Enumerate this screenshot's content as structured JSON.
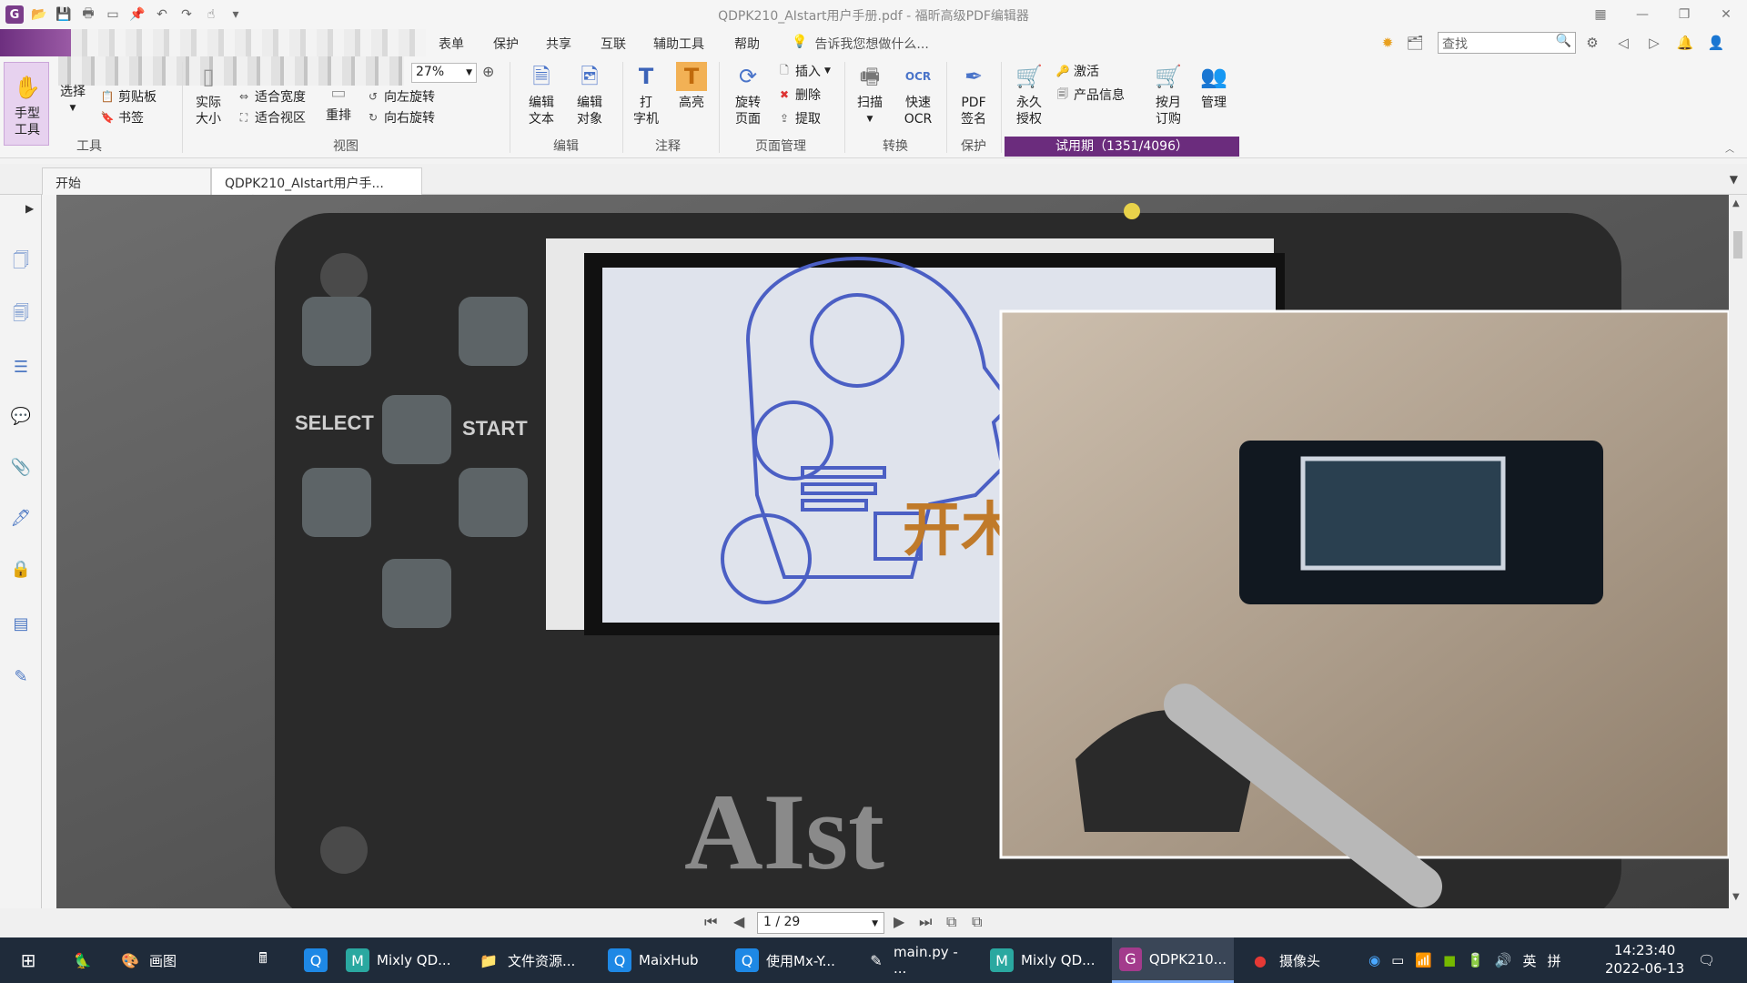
{
  "window": {
    "title": "QDPK210_AIstart用户手册.pdf - 福昕高级PDF编辑器",
    "minimize": "—",
    "restore": "❐",
    "close": "✕"
  },
  "menu": {
    "items": [
      "表单",
      "保护",
      "共享",
      "互联",
      "辅助工具",
      "帮助"
    ],
    "tellme": "告诉我您想做什么...",
    "search_placeholder": "查找"
  },
  "ribbon": {
    "hand_tool": "手型\n工具",
    "select": "选择",
    "clipboard": "剪贴板",
    "bookmark": "书签",
    "actual_size": "实际\n大小",
    "fit_width": "适合宽度",
    "fit_view": "适合视区",
    "reflow": "重排",
    "rotate_left": "向左旋转",
    "rotate_right": "向右旋转",
    "zoom": "27%",
    "edit_text": "编辑\n文本",
    "edit_object": "编辑\n对象",
    "typewriter": "打\n字机",
    "highlight": "高亮",
    "rotate_page": "旋转\n页面",
    "insert": "插入",
    "delete": "删除",
    "extract": "提取",
    "scan": "扫描",
    "quick_ocr": "快速\nOCR",
    "pdf_sign": "PDF\n签名",
    "perm_license": "永久\n授权",
    "activate": "激活",
    "product_info": "产品信息",
    "monthly": "按月\n订购",
    "manage": "管理",
    "trial": "试用期（1351/4096）",
    "groups": {
      "tools": "工具",
      "view": "视图",
      "edit": "编辑",
      "annotate": "注释",
      "page_mgmt": "页面管理",
      "convert": "转换",
      "protect": "保护"
    }
  },
  "tabs": [
    {
      "label": "开始"
    },
    {
      "label": "QDPK210_AIstart用户手..."
    }
  ],
  "doc": {
    "select_label": "SELECT",
    "start_label": "START",
    "brand_text": "AIst",
    "screen_chinese": "开木"
  },
  "pagenav": {
    "page": "1 / 29"
  },
  "taskbar": {
    "items": [
      {
        "label": "画图"
      },
      {
        "label": "Mixly QD..."
      },
      {
        "label": "文件资源..."
      },
      {
        "label": "MaixHub"
      },
      {
        "label": "使用Mx-Y..."
      },
      {
        "label": "main.py - ..."
      },
      {
        "label": "Mixly QD..."
      },
      {
        "label": "QDPK210..."
      },
      {
        "label": "摄像头"
      }
    ],
    "lang": "英",
    "ime": "拼",
    "time": "14:23:40",
    "date": "2022-06-13"
  },
  "colors": {
    "brand_purple": "#6b2c7d",
    "ribbon_blue": "#4a74c9",
    "taskbar_bg": "#1f2b3a"
  }
}
